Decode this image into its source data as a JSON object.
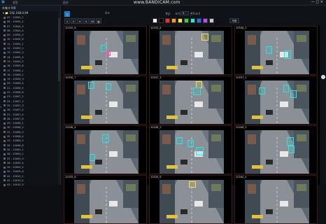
{
  "topbar": {
    "logo": "▣",
    "menu_left": "설정",
    "menu_mid": "옵션",
    "watermark": "www.BANDICAM.com",
    "win_controls": "— □ ×"
  },
  "tree": {
    "header": "카메라 목록",
    "root": "▾ 📁 192.168.0.99",
    "items": [
      "05 - 10004_1",
      "06 - 10004_2",
      "07 - 10004_3",
      "08 - 10004_4",
      "09 - 10004_5",
      "10 - 10004_6",
      "11 - 10005_1",
      "12 - 10005_2",
      "13 - 10005_3",
      "14 - 10005_4",
      "15 - 10005_5",
      "16 - 10005_6",
      "17 - 10006_1",
      "18 - 10006_2",
      "19 - 10006_3",
      "20 - 10006_4",
      "21 - 10006_5",
      "22 - 10006_6",
      "23 - 10007_1",
      "24 - 10007_2",
      "25 - 10007_3",
      "26 - 10007_4",
      "27 - 10007_5",
      "28 - 10007_6",
      "29 - 10008_1",
      "30 - 10008_2",
      "31 - 10008_3",
      "32 - 10008_4",
      "33 - 10008_5",
      "34 - 10008_6",
      "35 - 10009_1",
      "36 - 10009_2",
      "37 - 10009_3",
      "38 - 10009_4",
      "39 - 10009_5",
      "40 - 10009_6",
      "41 - 10010_1",
      "42 - 10010_2",
      "43 - 10010_3"
    ]
  },
  "toolbar": {
    "tab_label": "탭",
    "btn_a": "1",
    "btn_b": "2",
    "btn_c": "4",
    "btn_d": "9",
    "btn_e": "16",
    "btn_f": "▦",
    "mode_label": "모드",
    "color_label": "색상",
    "size_label": "크기",
    "size_value": "5",
    "font_label": "폰트크기",
    "apply_label": "적용",
    "colors": [
      "#ffffff",
      "#000000",
      "#ff2a2a",
      "#ff9a1f",
      "#ffe04a",
      "#33d04a",
      "#2fe0e0",
      "#2a6bff",
      "#c04aff",
      "#c8c8c8"
    ]
  },
  "cells": [
    {
      "id": "10035_6",
      "cap2": "",
      "boxes": [
        [
          "cyan"
        ],
        [
          "pink"
        ]
      ]
    },
    {
      "id": "10035_8",
      "cap2": "",
      "boxes": [
        [
          "yellow"
        ]
      ]
    },
    {
      "id": "10036_5",
      "cap2": "",
      "boxes": [
        [
          "cyan"
        ],
        [
          "cyan"
        ]
      ]
    },
    {
      "id": "10036_7",
      "cap2": "",
      "boxes": [
        [
          "cyan"
        ],
        [
          "cyan"
        ]
      ]
    },
    {
      "id": "10037_3",
      "cap2": "",
      "boxes": [
        [
          "yellow"
        ],
        [
          "cyan"
        ]
      ]
    },
    {
      "id": "10037_1",
      "cap2": "",
      "boxes": [
        [
          "cyan"
        ],
        [
          "cyan"
        ],
        [
          "cyan"
        ]
      ]
    },
    {
      "id": "10038_4",
      "cap2": "",
      "boxes": [
        [
          "cyan"
        ],
        [
          "cyan"
        ]
      ]
    },
    {
      "id": "10038_2",
      "cap2": "",
      "boxes": [
        [
          "cyan"
        ],
        [
          "cyan"
        ],
        [
          "cyan"
        ]
      ]
    },
    {
      "id": "10038_5",
      "cap2": "",
      "boxes": [
        [
          "cyan"
        ],
        [
          "cyan"
        ]
      ]
    },
    {
      "id": "10039_6",
      "cap2": "",
      "boxes": []
    },
    {
      "id": "10039_8",
      "cap2": "",
      "boxes": [
        [
          "yellow"
        ]
      ]
    },
    {
      "id": "10040_4",
      "cap2": "",
      "boxes": []
    }
  ]
}
